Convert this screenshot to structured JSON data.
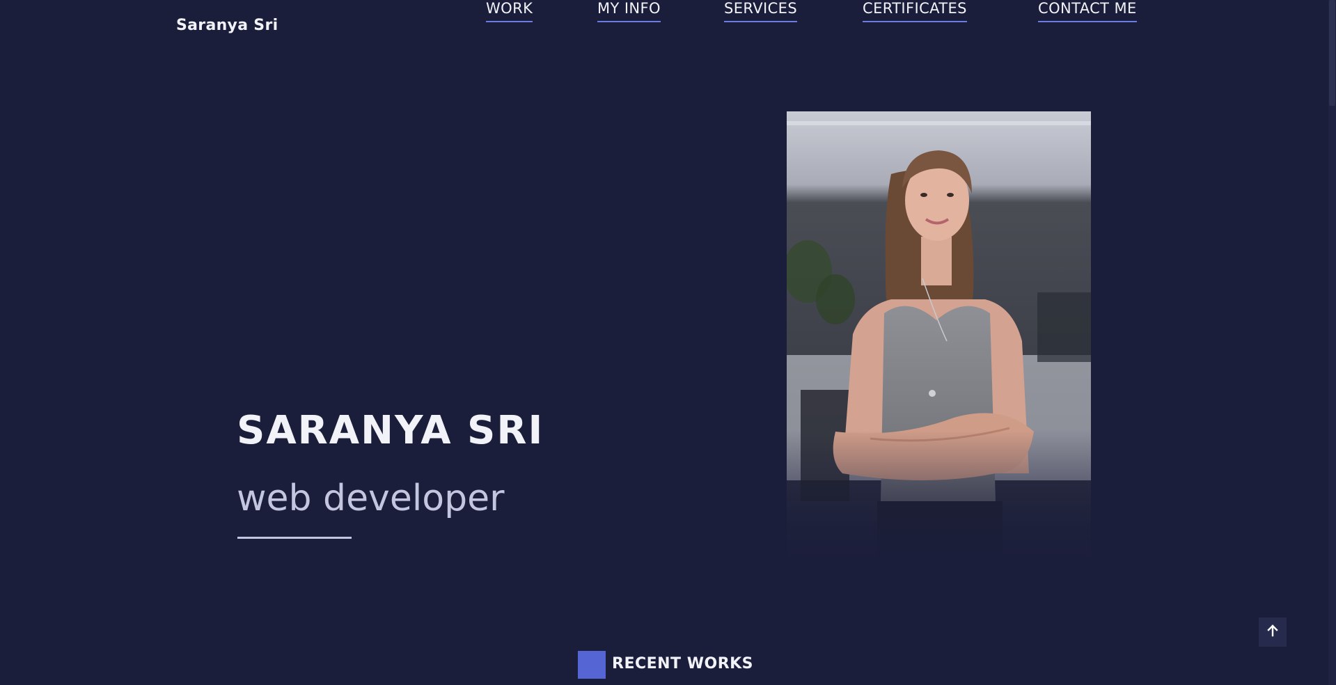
{
  "header": {
    "brand": "Saranya Sri",
    "nav": [
      {
        "label": "WORK"
      },
      {
        "label": "MY INFO"
      },
      {
        "label": "SERVICES"
      },
      {
        "label": "CERTIFICATES"
      },
      {
        "label": "CONTACT ME"
      }
    ]
  },
  "hero": {
    "name": "SARANYA SRI",
    "role": "web developer"
  },
  "recent": {
    "title": "RECENT WORKS"
  },
  "icons": {
    "scroll_top": "arrow-up-icon",
    "portrait": "portrait-photo"
  },
  "colors": {
    "background": "#1b1e3b",
    "accent": "#5566d4",
    "nav_underline": "#6b7de3"
  }
}
